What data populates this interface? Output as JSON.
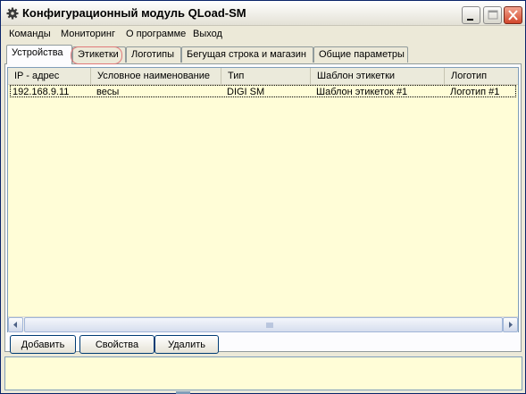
{
  "window": {
    "title": "Конфигурационный модуль QLoad-SM"
  },
  "menu": [
    "Команды",
    "Мониторинг",
    "О программе",
    "Выход"
  ],
  "tabs": [
    {
      "label": "Устройства",
      "active": true
    },
    {
      "label": "Этикетки",
      "active": false
    },
    {
      "label": "Логотипы",
      "active": false
    },
    {
      "label": "Бегущая строка и магазин",
      "active": false
    },
    {
      "label": "Общие параметры",
      "active": false
    }
  ],
  "table": {
    "columns": [
      "IP - адрес",
      "Условное наименование",
      "Тип",
      "Шаблон этикетки",
      "Логотип"
    ],
    "rows": [
      [
        "192.168.9.11",
        "весы",
        "DIGI SM",
        "Шаблон этикеток #1",
        "Логотип #1"
      ]
    ]
  },
  "buttons": {
    "add": "Добавить",
    "properties": "Свойства",
    "delete": "Удалить"
  },
  "colors": {
    "list_bg": "#fffdd7",
    "close_button": "#d2462b",
    "tab_highlight": "#e07a7a"
  },
  "icons": {
    "app": "gear-icon",
    "minimize": "minimize-icon",
    "maximize": "maximize-icon",
    "close": "close-icon"
  }
}
